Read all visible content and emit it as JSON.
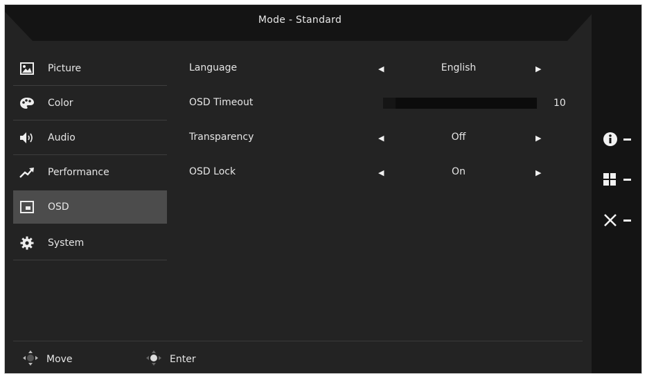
{
  "header": {
    "title": "Mode - Standard"
  },
  "sidebar": {
    "items": [
      {
        "label": "Picture",
        "icon": "picture-icon",
        "selected": false
      },
      {
        "label": "Color",
        "icon": "palette-icon",
        "selected": false
      },
      {
        "label": "Audio",
        "icon": "speaker-icon",
        "selected": false
      },
      {
        "label": "Performance",
        "icon": "trend-up-icon",
        "selected": false
      },
      {
        "label": "OSD",
        "icon": "osd-window-icon",
        "selected": true
      },
      {
        "label": "System",
        "icon": "gear-icon",
        "selected": false
      }
    ]
  },
  "settings": {
    "language": {
      "label": "Language",
      "value": "English"
    },
    "osd_timeout": {
      "label": "OSD Timeout",
      "value": "10"
    },
    "transparency": {
      "label": "Transparency",
      "value": "Off"
    },
    "osd_lock": {
      "label": "OSD Lock",
      "value": "On"
    }
  },
  "hotkeys": [
    {
      "icon": "info-icon"
    },
    {
      "icon": "grid-icon"
    },
    {
      "icon": "close-icon"
    }
  ],
  "footer": {
    "move_label": "Move",
    "enter_label": "Enter"
  },
  "colors": {
    "background": "#232323",
    "selected": "#4c4c4c",
    "side_panel": "#141414",
    "text": "#e6e6e6"
  }
}
